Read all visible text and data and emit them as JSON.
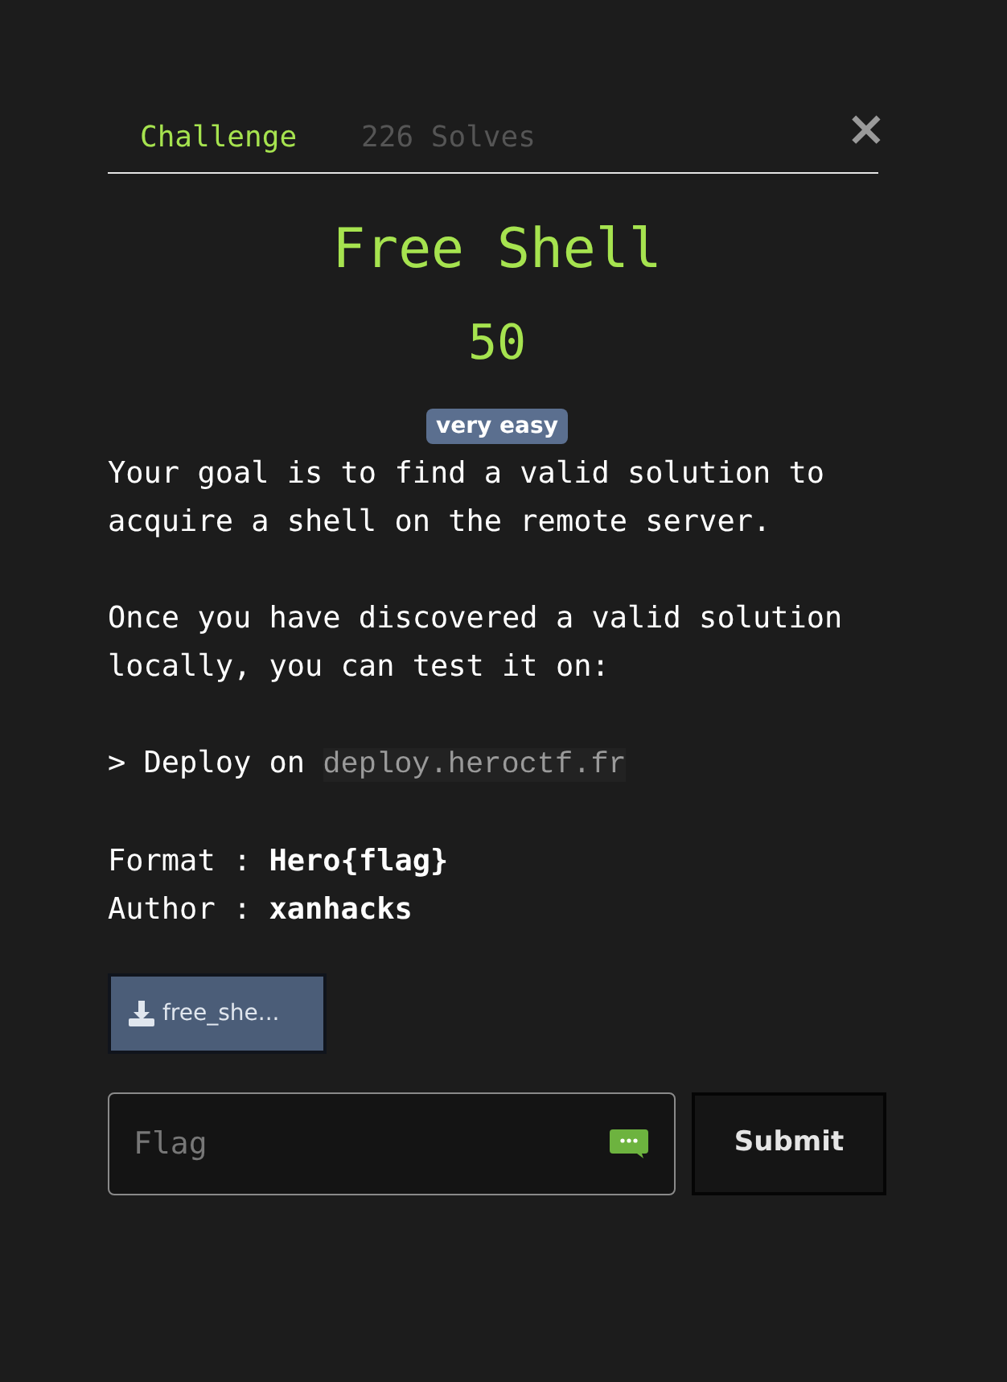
{
  "tabs": [
    {
      "label": "Challenge",
      "selected": true
    },
    {
      "label": "226 Solves",
      "selected": false
    }
  ],
  "close": "×",
  "title": "Free Shell",
  "points": "50",
  "difficulty": "very easy",
  "description": [
    "Your goal is to find a valid solution to acquire a shell on the remote server.",
    "Once you have discovered a valid solution locally, you can test it on:"
  ],
  "deploy": {
    "text": "> Deploy on",
    "host": "deploy.heroctf.fr"
  },
  "meta": [
    "Format : **Hero{flag}**",
    "Author : **xanhacks**"
  ],
  "file": {
    "label": "free_she..."
  },
  "flag_input": {
    "placeholder": "Flag"
  },
  "submit": "Submit"
}
